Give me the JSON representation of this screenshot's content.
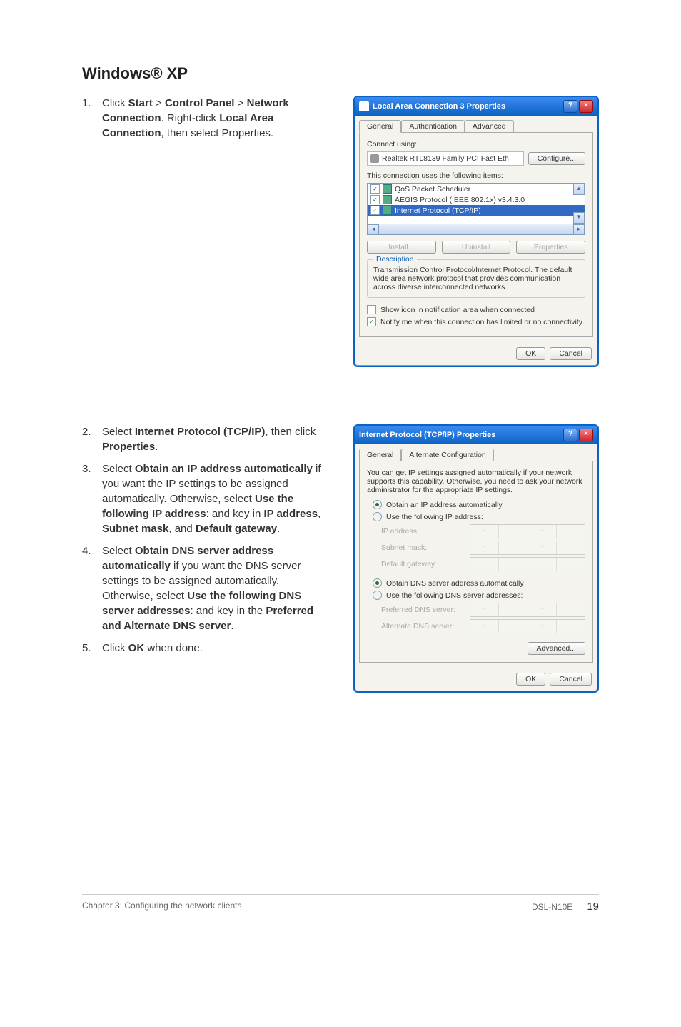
{
  "heading": "Windows® XP",
  "step1": {
    "num": "1.",
    "pre": "Click ",
    "start": "Start",
    "gt1": " > ",
    "cp": "Control Panel",
    "gt2": " > ",
    "nc": "Network Connection",
    "mid1": ". Right-click ",
    "lac": "Local Area Connection",
    "mid2": ", then select Properties."
  },
  "step2": {
    "num": "2.",
    "pre": "Select ",
    "ipt": "Internet Protocol (TCP/IP)",
    "mid": ", then click ",
    "props": "Properties",
    "end": "."
  },
  "step3": {
    "num": "3.",
    "pre": "Select ",
    "obtain": "Obtain an IP address automatically",
    "mid1": " if you want the IP settings to be assigned automatically. Otherwise, select ",
    "usefip": "Use the following IP address",
    "mid2": ": and key in ",
    "ipaddr": "IP address",
    "comma1": ", ",
    "subnet": "Subnet mask",
    "comma2": ", and ",
    "gateway": "Default gateway",
    "end": "."
  },
  "step4": {
    "num": "4.",
    "pre": "Select ",
    "obtaindns": "Obtain DNS server address automatically",
    "mid1": " if you want the DNS server settings to be assigned automatically. Otherwise, select ",
    "usedns": "Use the following DNS server addresses",
    "mid2": ": and key in the ",
    "prefalt": "Preferred and Alternate DNS server",
    "end": "."
  },
  "step5": {
    "num": "5.",
    "pre": "Click ",
    "ok": "OK",
    "end": " when done."
  },
  "dialog1": {
    "title": "Local Area Connection 3 Properties",
    "tab_general": "General",
    "tab_auth": "Authentication",
    "tab_adv": "Advanced",
    "connect_using": "Connect using:",
    "adapter": "Realtek RTL8139 Family PCI Fast Eth",
    "configure": "Configure...",
    "uses_items": "This connection uses the following items:",
    "item_qos": "QoS Packet Scheduler",
    "item_aegis": "AEGIS Protocol (IEEE 802.1x) v3.4.3.0",
    "item_tcpip": "Internet Protocol (TCP/IP)",
    "install": "Install...",
    "uninstall": "Uninstall",
    "properties": "Properties",
    "desc_legend": "Description",
    "desc_text": "Transmission Control Protocol/Internet Protocol. The default wide area network protocol that provides communication across diverse interconnected networks.",
    "show_icon": "Show icon in notification area when connected",
    "notify": "Notify me when this connection has limited or no connectivity",
    "ok": "OK",
    "cancel": "Cancel"
  },
  "dialog2": {
    "title": "Internet Protocol (TCP/IP) Properties",
    "tab_general": "General",
    "tab_alt": "Alternate Configuration",
    "intro": "You can get IP settings assigned automatically if your network supports this capability. Otherwise, you need to ask your network administrator for the appropriate IP settings.",
    "obtain_ip": "Obtain an IP address automatically",
    "use_ip": "Use the following IP address:",
    "ip_address": "IP address:",
    "subnet": "Subnet mask:",
    "gateway": "Default gateway:",
    "obtain_dns": "Obtain DNS server address automatically",
    "use_dns": "Use the following DNS server addresses:",
    "pref_dns": "Preferred DNS server:",
    "alt_dns": "Alternate DNS server:",
    "advanced": "Advanced...",
    "ok": "OK",
    "cancel": "Cancel"
  },
  "footer": {
    "left": "Chapter 3: Configuring the network clients",
    "model": "DSL-N10E",
    "page": "19"
  }
}
